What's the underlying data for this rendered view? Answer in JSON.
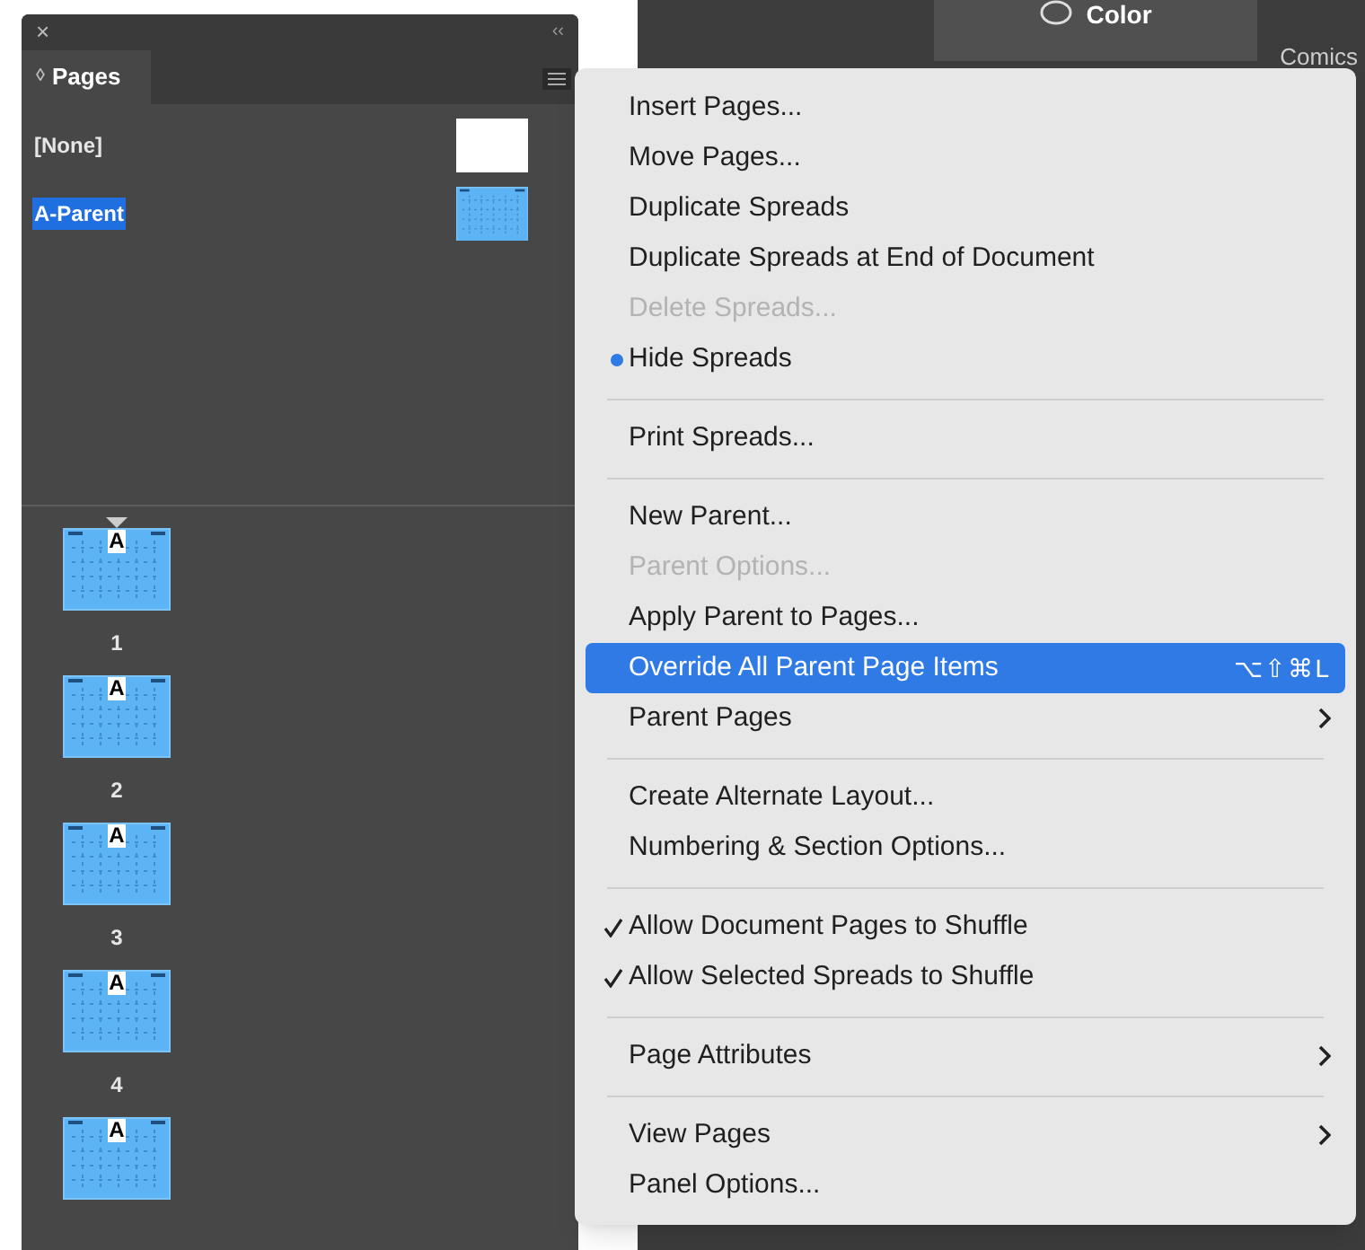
{
  "panel": {
    "close": "×",
    "collapse": "‹‹",
    "tab": {
      "icon": "◊",
      "label": "Pages"
    },
    "parents": [
      {
        "label": "[None]",
        "selected": false,
        "kind": "blank"
      },
      {
        "label": "A-Parent",
        "selected": true,
        "kind": "grid"
      }
    ],
    "pages": [
      {
        "prefix": "A",
        "number": "1",
        "current": true
      },
      {
        "prefix": "A",
        "number": "2"
      },
      {
        "prefix": "A",
        "number": "3"
      },
      {
        "prefix": "A",
        "number": "4"
      },
      {
        "prefix": "A"
      }
    ]
  },
  "background": {
    "button": "Color",
    "label": "Comics"
  },
  "menu": [
    {
      "kind": "item",
      "label": "Insert Pages...",
      "disabled": false,
      "selected": false
    },
    {
      "kind": "item",
      "label": "Move Pages...",
      "disabled": false,
      "selected": false
    },
    {
      "kind": "item",
      "label": "Duplicate Spreads",
      "disabled": false,
      "selected": false
    },
    {
      "kind": "item",
      "label": "Duplicate Spreads at End of Document",
      "disabled": false,
      "selected": false
    },
    {
      "kind": "item",
      "label": "Delete Spreads...",
      "disabled": true,
      "selected": false
    },
    {
      "kind": "item",
      "label": "Hide Spreads",
      "disabled": false,
      "selected": false,
      "bullet": true
    },
    {
      "kind": "separator"
    },
    {
      "kind": "item",
      "label": "Print Spreads...",
      "disabled": false,
      "selected": false
    },
    {
      "kind": "separator"
    },
    {
      "kind": "item",
      "label": "New Parent...",
      "disabled": false,
      "selected": false
    },
    {
      "kind": "item",
      "label": "Parent Options...",
      "disabled": true,
      "selected": false
    },
    {
      "kind": "item",
      "label": "Apply Parent to Pages...",
      "disabled": false,
      "selected": false
    },
    {
      "kind": "item",
      "label": "Override All Parent Page Items",
      "disabled": false,
      "selected": true,
      "shortcut": "⌥⇧⌘L"
    },
    {
      "kind": "item",
      "label": "Parent Pages",
      "disabled": false,
      "selected": false,
      "submenu": true
    },
    {
      "kind": "separator"
    },
    {
      "kind": "item",
      "label": "Create Alternate Layout...",
      "disabled": false,
      "selected": false
    },
    {
      "kind": "item",
      "label": "Numbering & Section Options...",
      "disabled": false,
      "selected": false
    },
    {
      "kind": "separator"
    },
    {
      "kind": "item",
      "label": "Allow Document Pages to Shuffle",
      "disabled": false,
      "selected": false,
      "checked": true
    },
    {
      "kind": "item",
      "label": "Allow Selected Spreads to Shuffle",
      "disabled": false,
      "selected": false,
      "checked": true
    },
    {
      "kind": "separator"
    },
    {
      "kind": "item",
      "label": "Page Attributes",
      "disabled": false,
      "selected": false,
      "submenu": true
    },
    {
      "kind": "separator"
    },
    {
      "kind": "item",
      "label": "View Pages",
      "disabled": false,
      "selected": false,
      "submenu": true
    },
    {
      "kind": "item",
      "label": "Panel Options...",
      "disabled": false,
      "selected": false
    }
  ]
}
